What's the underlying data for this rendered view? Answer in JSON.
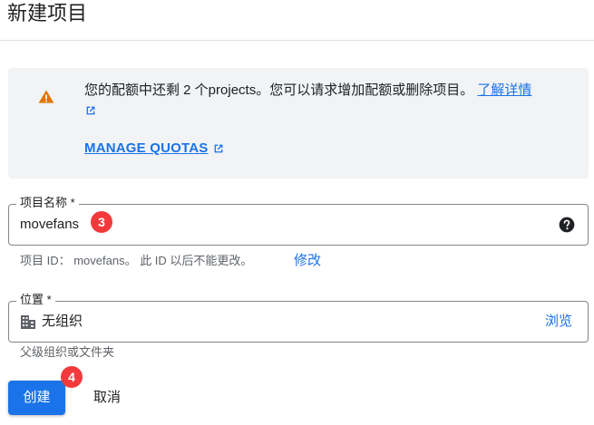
{
  "page": {
    "title": "新建项目"
  },
  "quota_banner": {
    "message": "您的配额中还剩 2 个projects。您可以请求增加配额或删除项目。",
    "learn_more": "了解详情",
    "manage_quotas": "MANAGE QUOTAS",
    "icon": "warning-icon",
    "icon_color": "#e37400"
  },
  "project_name_field": {
    "label": "项目名称 *",
    "value": "movefans",
    "badge": "3",
    "help_icon": "help-circle-icon"
  },
  "project_id_hint": {
    "text": "项目 ID： movefans。 此 ID 以后不能更改。",
    "edit_label": "修改"
  },
  "location_field": {
    "label": "位置 *",
    "value": "无组织",
    "browse_label": "浏览",
    "icon": "building-icon",
    "hint": "父级组织或文件夹"
  },
  "actions": {
    "create_label": "创建",
    "create_badge": "4",
    "cancel_label": "取消"
  },
  "colors": {
    "accent": "#1a73e8",
    "badge": "#f23a3c",
    "banner_bg": "#f1f3f4"
  }
}
